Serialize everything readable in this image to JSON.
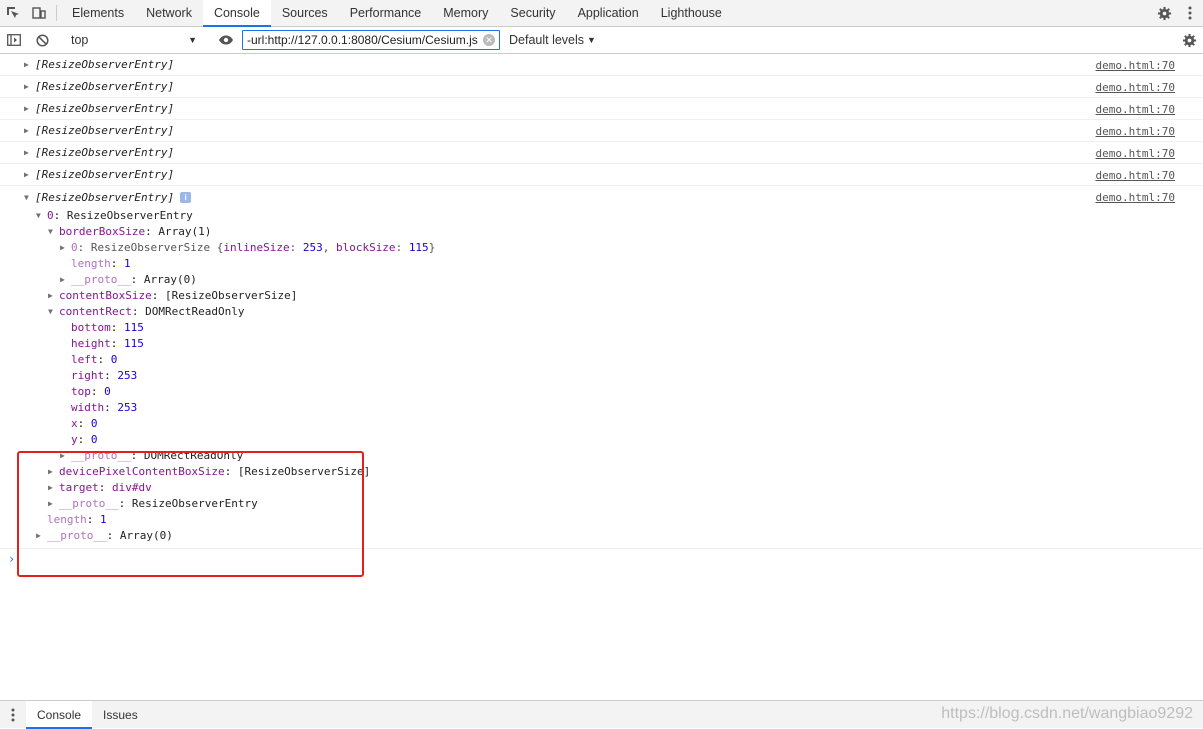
{
  "toolbar": {
    "tabs": [
      "Elements",
      "Network",
      "Console",
      "Sources",
      "Performance",
      "Memory",
      "Security",
      "Application",
      "Lighthouse"
    ],
    "active_tab": "Console"
  },
  "filterbar": {
    "context": "top",
    "filter_value": "-url:http://127.0.0.1:8080/Cesium/Cesium.js",
    "levels_label": "Default levels"
  },
  "console": {
    "collapsed_entries": [
      {
        "text": "[ResizeObserverEntry]",
        "source": "demo.html:70"
      },
      {
        "text": "[ResizeObserverEntry]",
        "source": "demo.html:70"
      },
      {
        "text": "[ResizeObserverEntry]",
        "source": "demo.html:70"
      },
      {
        "text": "[ResizeObserverEntry]",
        "source": "demo.html:70"
      },
      {
        "text": "[ResizeObserverEntry]",
        "source": "demo.html:70"
      },
      {
        "text": "[ResizeObserverEntry]",
        "source": "demo.html:70"
      }
    ],
    "expanded": {
      "text": "[ResizeObserverEntry]",
      "source": "demo.html:70",
      "item0": {
        "key": "0",
        "value": "ResizeObserverEntry"
      },
      "borderBoxSize": {
        "key": "borderBoxSize",
        "value": "Array(1)"
      },
      "bbs_item0": {
        "key": "0",
        "type": "ResizeObserverSize",
        "open": "{",
        "k1": "inlineSize",
        "v1": "253",
        "k2": "blockSize",
        "v2": "115",
        "close": "}"
      },
      "bbs_length": {
        "key": "length",
        "value": "1"
      },
      "bbs_proto": {
        "key": "__proto__",
        "value": "Array(0)"
      },
      "contentBoxSize": {
        "key": "contentBoxSize",
        "value": "[ResizeObserverSize]"
      },
      "contentRect": {
        "key": "contentRect",
        "value": "DOMRectReadOnly"
      },
      "rect_props": [
        {
          "key": "bottom",
          "value": "115"
        },
        {
          "key": "height",
          "value": "115"
        },
        {
          "key": "left",
          "value": "0"
        },
        {
          "key": "right",
          "value": "253"
        },
        {
          "key": "top",
          "value": "0"
        },
        {
          "key": "width",
          "value": "253"
        },
        {
          "key": "x",
          "value": "0"
        },
        {
          "key": "y",
          "value": "0"
        }
      ],
      "rect_proto": {
        "key": "__proto__",
        "value": "DOMRectReadOnly"
      },
      "devicePixelContentBoxSize": {
        "key": "devicePixelContentBoxSize",
        "value": "[ResizeObserverSize]"
      },
      "target": {
        "key": "target",
        "value": "div#dv"
      },
      "entry_proto": {
        "key": "__proto__",
        "value": "ResizeObserverEntry"
      },
      "length": {
        "key": "length",
        "value": "1"
      },
      "proto": {
        "key": "__proto__",
        "value": "Array(0)"
      }
    },
    "prompt": "›"
  },
  "drawer": {
    "tabs": [
      "Console",
      "Issues"
    ]
  },
  "watermark": "https://blog.csdn.net/wangbiao9292",
  "colors": {
    "accent": "#1a73e8",
    "highlight_box": "#e0221b",
    "key": "#881391",
    "number": "#1c00cf"
  }
}
